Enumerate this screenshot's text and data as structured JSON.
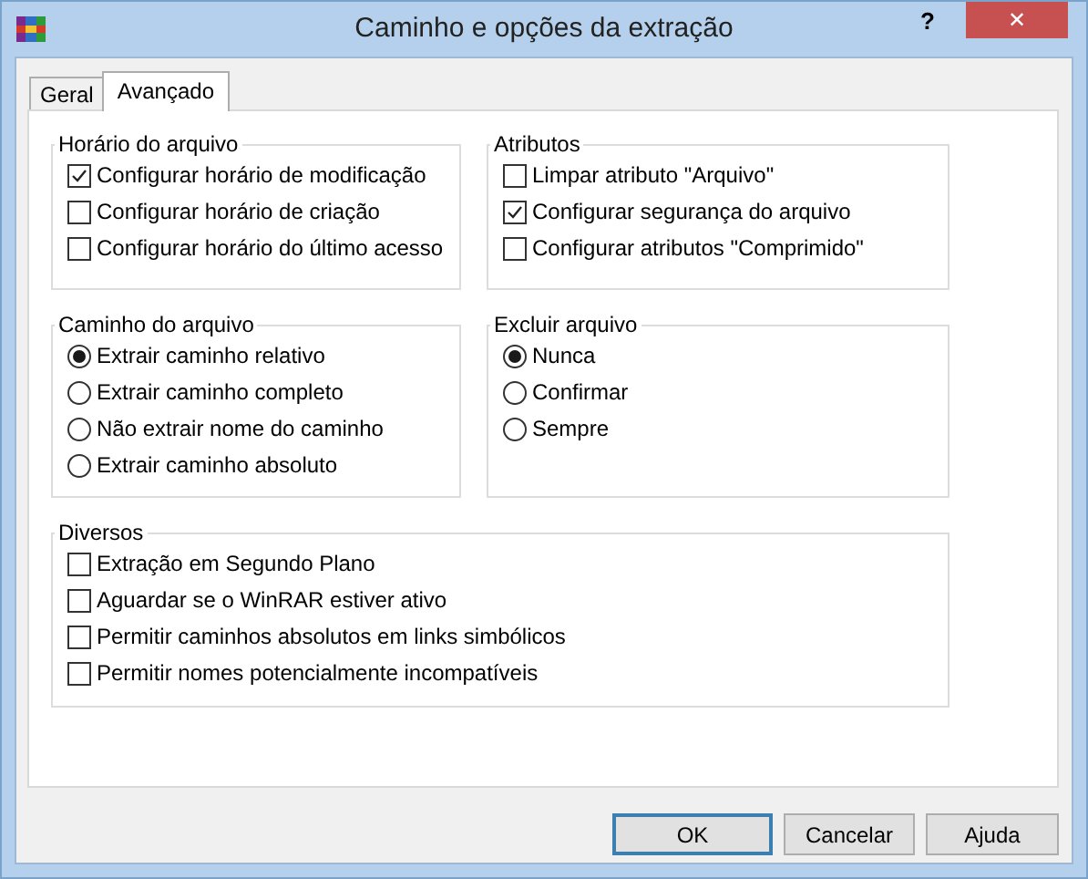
{
  "window": {
    "title": "Caminho e opções da extração",
    "help": "?",
    "close": "✕"
  },
  "tabs": [
    {
      "label": "Geral",
      "selected": false
    },
    {
      "label": "Avançado",
      "selected": true
    }
  ],
  "rows": [
    [
      {
        "title": "Horário do arquivo",
        "kind": "checkbox",
        "options": [
          {
            "label": "Configurar horário de modificação",
            "checked": true
          },
          {
            "label": "Configurar horário de criação",
            "checked": false
          },
          {
            "label": "Configurar horário do último acesso",
            "checked": false
          }
        ]
      },
      {
        "title": "Atributos",
        "kind": "checkbox",
        "options": [
          {
            "label": "Limpar atributo \"Arquivo\"",
            "checked": false
          },
          {
            "label": "Configurar segurança do arquivo",
            "checked": true
          },
          {
            "label": "Configurar atributos \"Comprimido\"",
            "checked": false
          }
        ]
      }
    ],
    [
      {
        "title": "Caminho do arquivo",
        "kind": "radio",
        "options": [
          {
            "label": "Extrair caminho relativo",
            "selected": true
          },
          {
            "label": "Extrair caminho completo",
            "selected": false
          },
          {
            "label": "Não extrair nome do caminho",
            "selected": false
          },
          {
            "label": "Extrair caminho absoluto",
            "selected": false
          }
        ]
      },
      {
        "title": "Excluir arquivo",
        "kind": "radio",
        "options": [
          {
            "label": "Nunca",
            "selected": true
          },
          {
            "label": "Confirmar",
            "selected": false
          },
          {
            "label": "Sempre",
            "selected": false
          }
        ]
      }
    ],
    [
      {
        "title": "Diversos",
        "kind": "checkbox",
        "options": [
          {
            "label": "Extração em Segundo Plano",
            "checked": false
          },
          {
            "label": "Aguardar se o WinRAR estiver ativo",
            "checked": false
          },
          {
            "label": "Permitir caminhos absolutos em links simbólicos",
            "checked": false
          },
          {
            "label": "Permitir nomes potencialmente incompatíveis",
            "checked": false
          }
        ]
      }
    ]
  ],
  "buttons": [
    {
      "label": "OK",
      "default": true
    },
    {
      "label": "Cancelar",
      "default": false
    },
    {
      "label": "Ajuda",
      "default": false
    }
  ]
}
